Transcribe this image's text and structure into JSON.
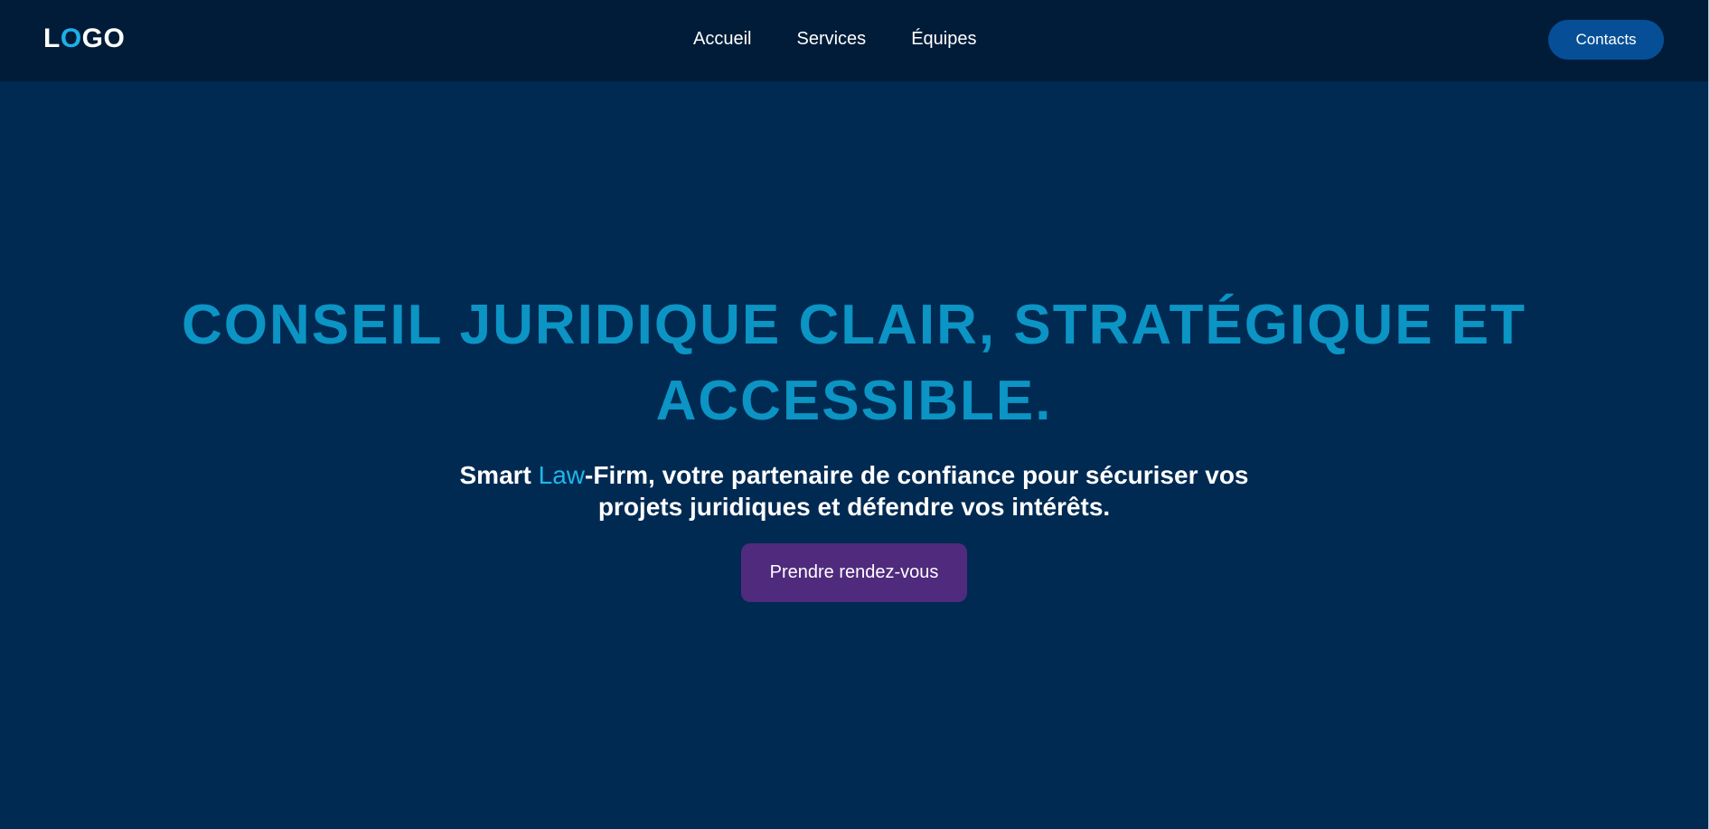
{
  "header": {
    "logo": {
      "part1": "L",
      "part2": "O",
      "part3": "GO"
    },
    "nav": {
      "items": [
        {
          "label": "Accueil"
        },
        {
          "label": "Services"
        },
        {
          "label": "Équipes"
        }
      ]
    },
    "contacts_label": "Contacts"
  },
  "hero": {
    "title": "CONSEIL JURIDIQUE CLAIR, STRATÉGIQUE ET ACCESSIBLE.",
    "subtitle": {
      "part1": "Smart ",
      "highlight": "Law",
      "part2": "-Firm, votre partenaire de confiance pour sécuriser vos projets juridiques et défendre vos intérêts."
    },
    "cta_label": "Prendre rendez-vous"
  },
  "colors": {
    "background": "#002a52",
    "header_background": "#001c38",
    "title": "#0b94c4",
    "accent": "#1eb0e6",
    "contacts_button": "#064f96",
    "cta_button": "#4f2a7d"
  }
}
